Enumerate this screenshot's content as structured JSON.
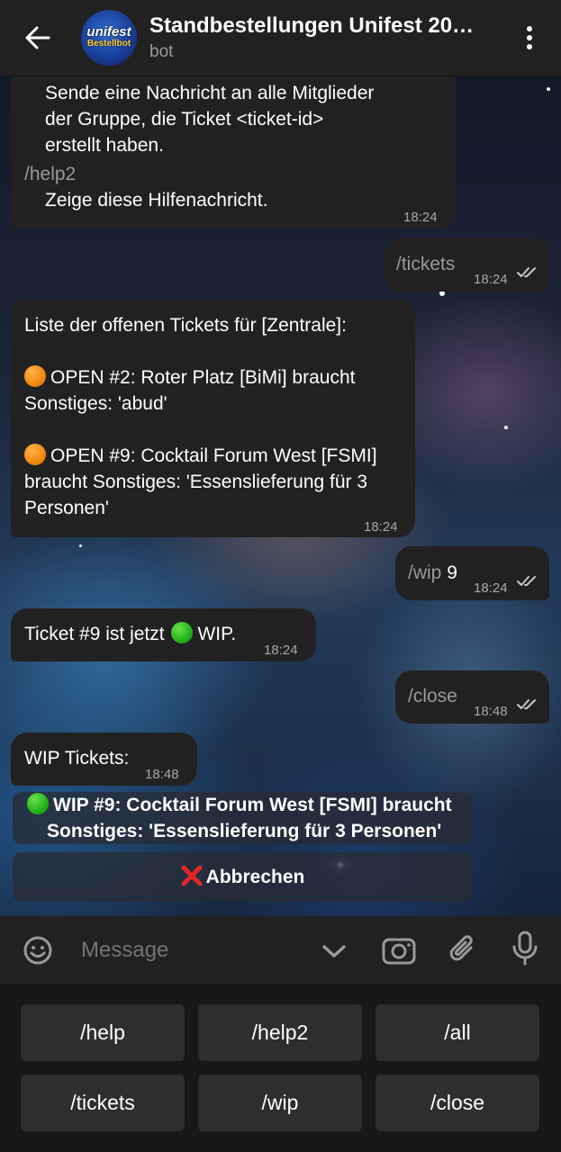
{
  "header": {
    "title": "Standbestellungen Unifest 20…",
    "subtitle": "bot",
    "avatar_text_top": "unifest",
    "avatar_text_bottom": "Bestellbot"
  },
  "messages": {
    "m1": {
      "line1": "Sende eine Nachricht an alle Mitglieder",
      "line2": "der Gruppe, die Ticket <ticket-id>",
      "line3": "erstellt haben.",
      "cmd": "/help2",
      "desc": "Zeige diese Hilfenachricht.",
      "time": "18:24"
    },
    "m2": {
      "text": "/tickets",
      "time": "18:24"
    },
    "m3": {
      "line1": "Liste der offenen Tickets für [Zentrale]:",
      "t1_line1": "OPEN #2: Roter Platz [BiMi] braucht",
      "t1_line2": "Sonstiges: 'abud'",
      "t2_line1": "OPEN #9: Cocktail Forum West [FSMI]",
      "t2_line2": "braucht Sonstiges: 'Essenslieferung für 3",
      "t2_line3": "Personen'",
      "time": "18:24"
    },
    "m4": {
      "cmd": "/wip",
      "arg": "9",
      "time": "18:24"
    },
    "m5": {
      "pre": "Ticket #9 ist jetzt",
      "post": "WIP.",
      "time": "18:24"
    },
    "m6": {
      "text": "/close",
      "time": "18:48"
    },
    "m7": {
      "text": "WIP Tickets:",
      "time": "18:48"
    }
  },
  "inline_buttons": {
    "ticket_line1": "WIP #9: Cocktail Forum West [FSMI] braucht",
    "ticket_line2": "Sonstiges: 'Essenslieferung für 3 Personen'",
    "cancel": "Abbrechen"
  },
  "input": {
    "placeholder": "Message"
  },
  "keyboard": {
    "row1": [
      "/help",
      "/help2",
      "/all"
    ],
    "row2": [
      "/tickets",
      "/wip",
      "/close"
    ]
  },
  "icons": {
    "back": "arrow-left-icon",
    "menu": "more-vertical-icon",
    "emoji": "emoji-icon",
    "chevron": "chevron-down-icon",
    "camera": "camera-icon",
    "attach": "paperclip-icon",
    "mic": "microphone-icon"
  },
  "colors": {
    "bubble": "#212121",
    "header": "#212121",
    "keyboard_button": "#2e2e2e",
    "open_status": "#f0880e",
    "wip_status": "#23b21a",
    "cancel_status": "#e0262a"
  }
}
